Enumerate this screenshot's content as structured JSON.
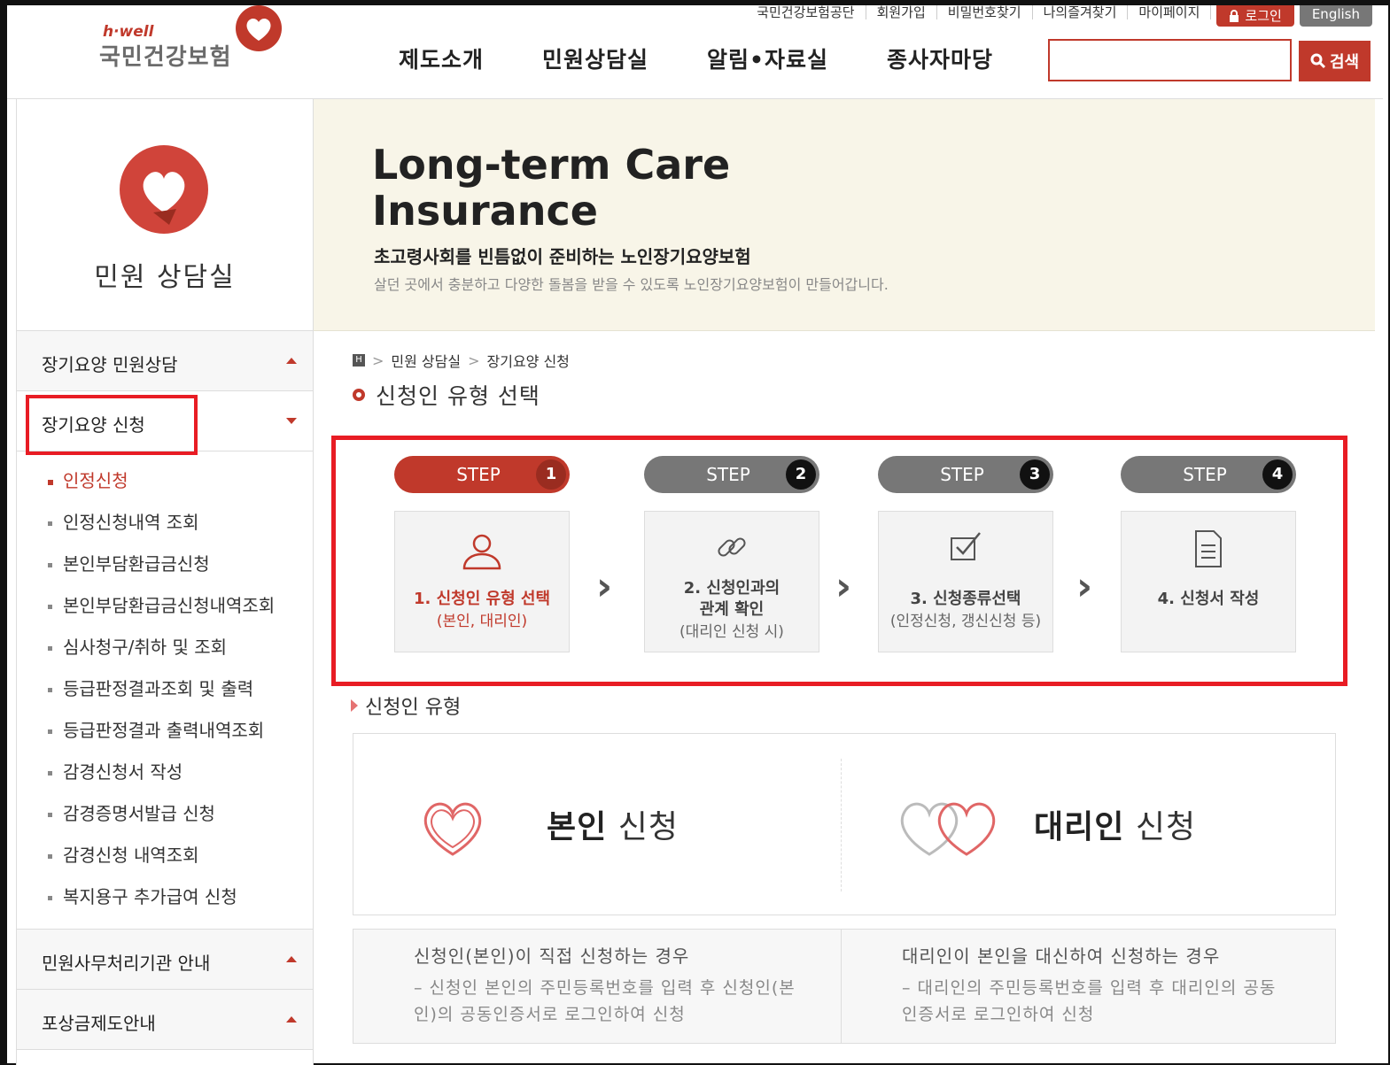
{
  "header": {
    "logo_brand": "h·well",
    "logo_name": "국민건강보험",
    "util_links": [
      "국민건강보험공단",
      "회원가입",
      "비밀번호찾기",
      "나의즐겨찾기",
      "마이페이지"
    ],
    "login_label": "로그인",
    "english_label": "English",
    "gnb": [
      "제도소개",
      "민원상담실",
      "알림•자료실",
      "종사자마당"
    ],
    "search_placeholder": "",
    "search_button": "검색"
  },
  "sidebar": {
    "title": "민원 상담실",
    "groups": [
      {
        "label": "장기요양 민원상담",
        "state": "collapsed"
      },
      {
        "label": "장기요양 신청",
        "state": "expanded"
      },
      {
        "label": "민원사무처리기관 안내",
        "state": "collapsed"
      },
      {
        "label": "포상금제도안내",
        "state": "collapsed"
      }
    ],
    "submenu": [
      "인정신청",
      "인정신청내역 조회",
      "본인부담환급금신청",
      "본인부담환급금신청내역조회",
      "심사청구/취하 및 조회",
      "등급판정결과조회 및 출력",
      "등급판정결과 출력내역조회",
      "감경신청서 작성",
      "감경증명서발급 신청",
      "감경신청 내역조회",
      "복지용구 추가급여 신청"
    ],
    "active_submenu_index": 0
  },
  "banner": {
    "title_line1": "Long-term Care",
    "title_line2": "Insurance",
    "subtitle": "초고령사회를 빈틈없이 준비하는 노인장기요양보험",
    "description": "살던 곳에서 충분하고 다양한 돌봄을 받을 수 있도록 노인장기요양보험이 만들어갑니다."
  },
  "breadcrumb": [
    "민원 상담실",
    "장기요양 신청"
  ],
  "page_title": "신청인 유형 선택",
  "steps": [
    {
      "pill": "STEP",
      "num": "1",
      "title": "1. 신청인 유형 선택",
      "sub": "(본인, 대리인)",
      "icon": "person-icon",
      "active": true
    },
    {
      "pill": "STEP",
      "num": "2",
      "title_l1": "2. 신청인과의",
      "title_l2": "관계 확인",
      "sub": "(대리인 신청 시)",
      "icon": "link-icon",
      "active": false
    },
    {
      "pill": "STEP",
      "num": "3",
      "title": "3. 신청종류선택",
      "sub": "(인정신청, 갱신신청 등)",
      "icon": "checkbox-icon",
      "active": false
    },
    {
      "pill": "STEP",
      "num": "4",
      "title": "4. 신청서 작성",
      "sub": "",
      "icon": "document-icon",
      "active": false
    }
  ],
  "section_title": "신청인 유형",
  "options": {
    "self_bold": "본인",
    "self_rest": " 신청",
    "agent_bold": "대리인",
    "agent_rest": " 신청"
  },
  "descriptions": {
    "self_head": "신청인(본인)이 직접 신청하는 경우",
    "self_body": "– 신청인 본인의 주민등록번호를 입력 후 신청인(본인)의 공동인증서로 로그인하여 신청",
    "agent_head": "대리인이 본인을 대신하여 신청하는 경우",
    "agent_body": "– 대리인의 주민등록번호를 입력 후 대리인의 공동인증서로 로그인하여 신청"
  },
  "colors": {
    "accent": "#c0392b",
    "highlight_box": "#e81c24",
    "banner_bg": "#f8f5e8"
  }
}
